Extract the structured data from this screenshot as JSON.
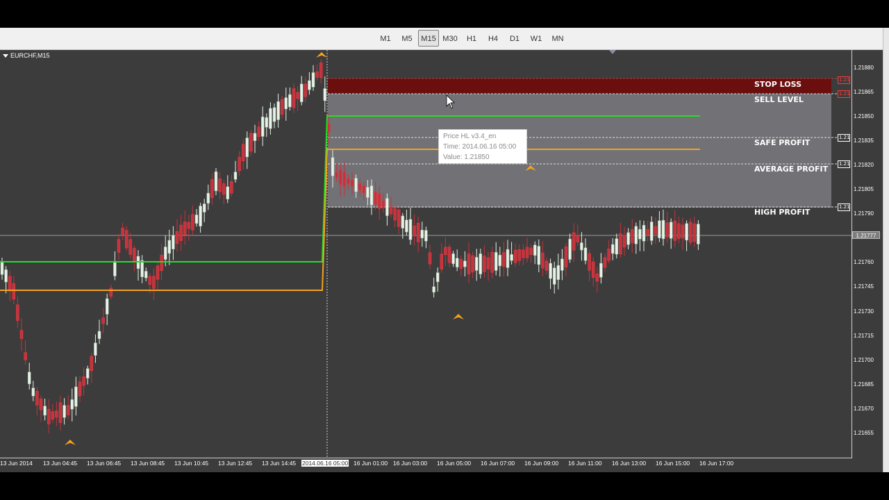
{
  "timeframes": [
    "M1",
    "M5",
    "M15",
    "M30",
    "H1",
    "H4",
    "D1",
    "W1",
    "MN"
  ],
  "active_timeframe": "M15",
  "symbol": "EURCHF,M15",
  "zones": {
    "stop_loss": "STOP LOSS",
    "sell_level": "SELL LEVEL",
    "safe_profit": "SAFE PROFIT",
    "average_profit": "AVERAGE PROFIT",
    "high_profit": "HIGH PROFIT"
  },
  "tooltip": {
    "line1": "Price HL v3.4_en",
    "line2": "Time: 2014.06.16 05:00",
    "line3": "Value: 1.21850"
  },
  "price_axis": [
    "1.21880",
    "1.21865",
    "1.21850",
    "1.21835",
    "1.21820",
    "1.21805",
    "1.21790",
    "1.21760",
    "1.21745",
    "1.21730",
    "1.21715",
    "1.21700",
    "1.21685",
    "1.21670",
    "1.21655"
  ],
  "current_price": "1.21777",
  "level_markers": [
    "1.21",
    "1.21",
    "1.21",
    "1.21",
    "1.21"
  ],
  "time_axis": [
    "13 Jun 2014",
    "13 Jun 04:45",
    "13 Jun 06:45",
    "13 Jun 08:45",
    "13 Jun 10:45",
    "13 Jun 12:45",
    "13 Jun 14:45",
    "2014.06.16 05:00",
    "16 Jun 01:00",
    "16 Jun 03:00",
    "16 Jun 05:00",
    "16 Jun 07:00",
    "16 Jun 09:00",
    "16 Jun 11:00",
    "16 Jun 13:00",
    "16 Jun 15:00",
    "16 Jun 17:00"
  ],
  "colors": {
    "chart_bg": "#3c3c3c",
    "bull_candle": "#e8f2e8",
    "bear_candle": "#c8323c",
    "green_line": "#22e022",
    "orange_line": "#f5a21e",
    "stop_loss_zone": "#6b0e0e",
    "profit_zone": "#7a7a80"
  }
}
